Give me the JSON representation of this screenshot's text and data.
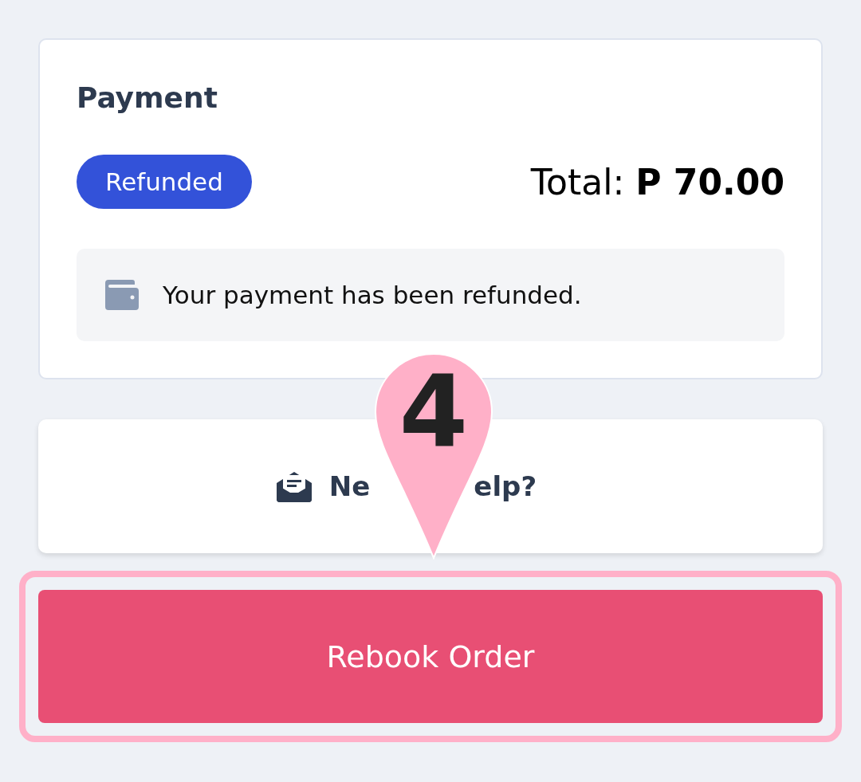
{
  "payment": {
    "title": "Payment",
    "status": "Refunded",
    "total": "Total: **P 70.00**",
    "notice": "Your payment has been refunded."
  },
  "help": {
    "label_parts": [
      "Ne",
      "elp?"
    ]
  },
  "marker": {
    "number": "4"
  },
  "rebook": {
    "label": "Rebook Order",
    "highlighted": true
  }
}
